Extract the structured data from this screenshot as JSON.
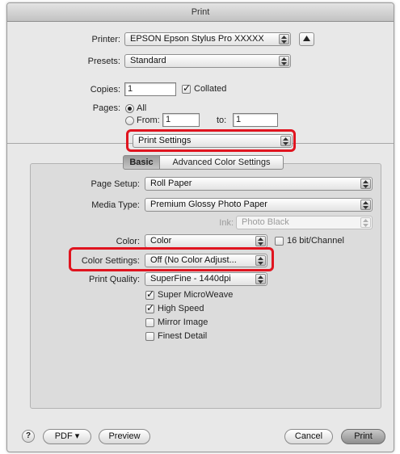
{
  "window": {
    "title": "Print"
  },
  "printer": {
    "label": "Printer:",
    "value": "EPSON Epson Stylus Pro XXXXX"
  },
  "presets": {
    "label": "Presets:",
    "value": "Standard"
  },
  "copies": {
    "label": "Copies:",
    "value": "1",
    "collated_label": "Collated",
    "collated": true
  },
  "pages": {
    "label": "Pages:",
    "all_label": "All",
    "from_label": "From:",
    "from_value": "1",
    "to_label": "to:",
    "to_value": "1"
  },
  "section_popup": {
    "value": "Print Settings"
  },
  "tabs": [
    {
      "label": "Basic",
      "selected": true
    },
    {
      "label": "Advanced Color Settings",
      "selected": false
    }
  ],
  "settings": {
    "page_setup": {
      "label": "Page Setup:",
      "value": "Roll Paper"
    },
    "media_type": {
      "label": "Media Type:",
      "value": "Premium Glossy Photo Paper"
    },
    "ink": {
      "label": "Ink:",
      "value": "Photo Black"
    },
    "color": {
      "label": "Color:",
      "value": "Color",
      "bit16_label": "16 bit/Channel",
      "bit16": false
    },
    "color_settings": {
      "label": "Color Settings:",
      "value": "Off (No Color Adjust..."
    },
    "print_quality": {
      "label": "Print Quality:",
      "value": "SuperFine - 1440dpi"
    },
    "options": [
      {
        "label": "Super MicroWeave",
        "checked": true
      },
      {
        "label": "High Speed",
        "checked": true
      },
      {
        "label": "Mirror Image",
        "checked": false
      },
      {
        "label": "Finest Detail",
        "checked": false
      }
    ]
  },
  "footer": {
    "help": "?",
    "pdf": "PDF ▾",
    "preview": "Preview",
    "cancel": "Cancel",
    "print": "Print"
  },
  "highlight_color": "#e0141f"
}
